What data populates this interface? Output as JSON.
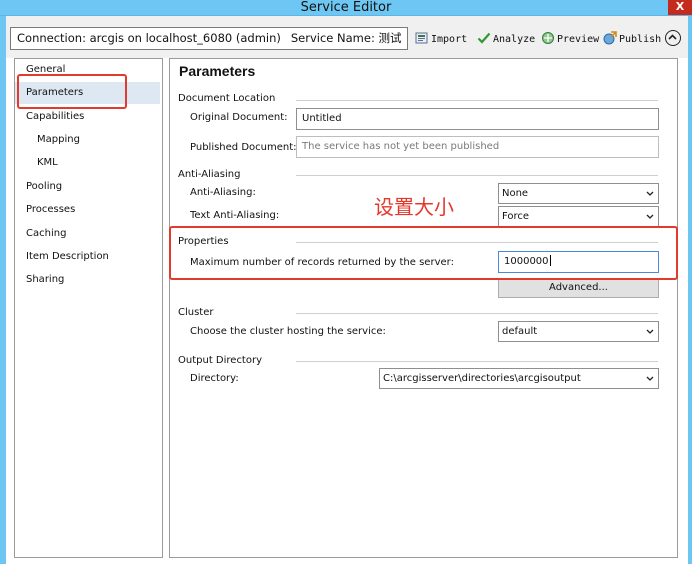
{
  "window": {
    "title": "Service Editor",
    "close": "X"
  },
  "toolbar": {
    "connection_label": "Connection: arcgis on localhost_6080 (admin)",
    "service_name_label": "Service Name: 测试",
    "import": "Import",
    "analyze": "Analyze",
    "preview": "Preview",
    "publish": "Publish"
  },
  "nav": {
    "items": [
      {
        "label": "General"
      },
      {
        "label": "Parameters"
      },
      {
        "label": "Capabilities"
      },
      {
        "label": "Mapping"
      },
      {
        "label": "KML"
      },
      {
        "label": "Pooling"
      },
      {
        "label": "Processes"
      },
      {
        "label": "Caching"
      },
      {
        "label": "Item Description"
      },
      {
        "label": "Sharing"
      }
    ],
    "selected": "Parameters"
  },
  "page": {
    "title": "Parameters",
    "document_location": {
      "heading": "Document Location",
      "original_label": "Original Document:",
      "original_value": "Untitled",
      "published_label": "Published Document:",
      "published_placeholder": "The service has not yet been published"
    },
    "anti_aliasing": {
      "heading": "Anti-Aliasing",
      "anti_label": "Anti-Aliasing:",
      "anti_value": "None",
      "text_label": "Text Anti-Aliasing:",
      "text_value": "Force"
    },
    "properties": {
      "heading": "Properties",
      "max_records_label": "Maximum number of records returned by the server:",
      "max_records_value": "1000000",
      "advanced_button": "Advanced..."
    },
    "cluster": {
      "heading": "Cluster",
      "label": "Choose the cluster hosting the service:",
      "value": "default"
    },
    "output_directory": {
      "heading": "Output Directory",
      "label": "Directory:",
      "value": "C:\\arcgisserver\\directories\\arcgisoutput"
    }
  },
  "annotation": {
    "text": "设置大小",
    "color": "#e5382a"
  },
  "colors": {
    "titlebar": "#6dc7f2",
    "selected_nav": "#dde8f3",
    "annotation_red": "#e23b2e"
  }
}
